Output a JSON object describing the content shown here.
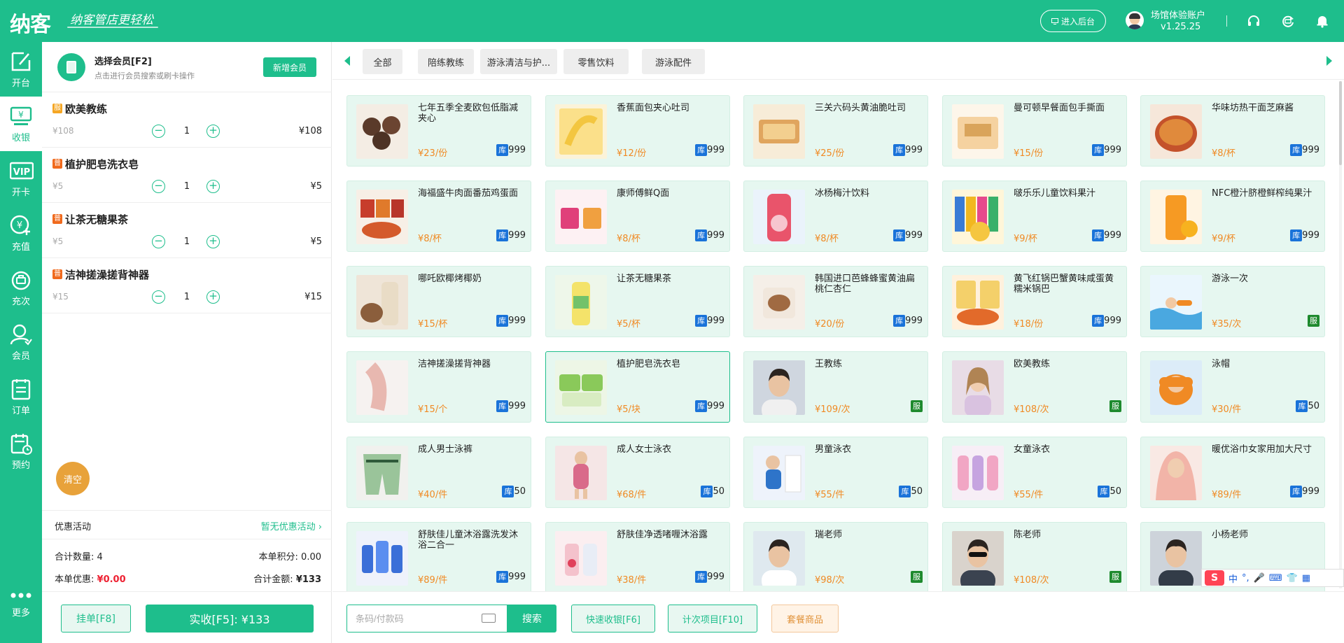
{
  "brand": {
    "logo": "纳客",
    "slogan": "纳客管店更轻松"
  },
  "header": {
    "backend_button": "进入后台",
    "account_name": "场馆体验账户",
    "version": "v1.25.25",
    "icons": [
      "headset-icon",
      "refresh-icon",
      "bell-icon"
    ]
  },
  "nav": [
    {
      "label": "开台",
      "icon": "edit-icon",
      "active": false
    },
    {
      "label": "收银",
      "icon": "cashier-icon",
      "active": true
    },
    {
      "label": "开卡",
      "icon": "vip-card-icon",
      "active": false
    },
    {
      "label": "充值",
      "icon": "recharge-icon",
      "active": false
    },
    {
      "label": "充次",
      "icon": "recharge-count-icon",
      "active": false
    },
    {
      "label": "会员",
      "icon": "member-icon",
      "active": false
    },
    {
      "label": "订单",
      "icon": "order-icon",
      "active": false
    },
    {
      "label": "预约",
      "icon": "calendar-icon",
      "active": false
    }
  ],
  "nav_more": "更多",
  "member": {
    "title": "选择会员[F2]",
    "hint": "点击进行会员搜索或刷卡操作",
    "new_member_button": "新增会员"
  },
  "cart_items": [
    {
      "tag": "服",
      "tag_type": "service",
      "name": "欧美教练",
      "unit_price": "¥108",
      "qty": "1",
      "subtotal": "¥108"
    },
    {
      "tag": "普",
      "tag_type": "normal",
      "name": "植护肥皂洗衣皂",
      "unit_price": "¥5",
      "qty": "1",
      "subtotal": "¥5"
    },
    {
      "tag": "普",
      "tag_type": "normal",
      "name": "让茶无糖果茶",
      "unit_price": "¥5",
      "qty": "1",
      "subtotal": "¥5"
    },
    {
      "tag": "普",
      "tag_type": "normal",
      "name": "洁神搓澡搓背神器",
      "unit_price": "¥15",
      "qty": "1",
      "subtotal": "¥15"
    }
  ],
  "cart": {
    "clear_button": "清空",
    "promo_label": "优惠活动",
    "promo_value": "暂无优惠活动",
    "total_qty_label": "合计数量:",
    "total_qty": "4",
    "points_label": "本单积分:",
    "points": "0.00",
    "discount_label": "本单优惠:",
    "discount": "¥0.00",
    "total_amount_label": "合计金额:",
    "total_amount": "¥133",
    "hang_button": "挂单[F8]",
    "pay_button": "实收[F5]: ¥133"
  },
  "categories": [
    {
      "label": "全部",
      "active": true
    },
    {
      "label": "陪练教练",
      "active": false
    },
    {
      "label": "游泳清洁与护...",
      "active": false
    },
    {
      "label": "零售饮料",
      "active": false
    },
    {
      "label": "游泳配件",
      "active": false
    }
  ],
  "products": [
    {
      "name": "七年五季全麦欧包低脂减夹心",
      "price": "¥23/份",
      "badge": "库",
      "stock": "999",
      "img": "bread"
    },
    {
      "name": "香蕉面包夹心吐司",
      "price": "¥12/份",
      "badge": "库",
      "stock": "999",
      "img": "banana"
    },
    {
      "name": "三关六码头黄油脆吐司",
      "price": "¥25/份",
      "badge": "库",
      "stock": "999",
      "img": "toast"
    },
    {
      "name": "曼可顿早餐面包手撕面",
      "price": "¥15/份",
      "badge": "库",
      "stock": "999",
      "img": "breadpack"
    },
    {
      "name": "华味坊热干面芝麻酱",
      "price": "¥8/杯",
      "badge": "库",
      "stock": "999",
      "img": "noodle"
    },
    {
      "name": "海福盛牛肉面番茄鸡蛋面",
      "price": "¥8/杯",
      "badge": "库",
      "stock": "999",
      "img": "cupnoodle"
    },
    {
      "name": "康师傅鲜Q面",
      "price": "¥8/杯",
      "badge": "库",
      "stock": "999",
      "img": "cups"
    },
    {
      "name": "冰杨梅汁饮料",
      "price": "¥8/杯",
      "badge": "库",
      "stock": "999",
      "img": "juice"
    },
    {
      "name": "啵乐乐儿童饮料果汁",
      "price": "¥9/杯",
      "badge": "库",
      "stock": "999",
      "img": "kids"
    },
    {
      "name": "NFC橙汁脐橙鲜榨纯果汁",
      "price": "¥9/杯",
      "badge": "库",
      "stock": "999",
      "img": "orange"
    },
    {
      "name": "哪吒欧椰烤椰奶",
      "price": "¥15/杯",
      "badge": "库",
      "stock": "999",
      "img": "coconut"
    },
    {
      "name": "让茶无糖果茶",
      "price": "¥5/杯",
      "badge": "库",
      "stock": "999",
      "img": "tea"
    },
    {
      "name": "韩国进口芭蜂蜂蜜黄油扁桃仁杏仁",
      "price": "¥20/份",
      "badge": "库",
      "stock": "999",
      "img": "almond"
    },
    {
      "name": "黄飞红锅巴蟹黄味咸蛋黄糯米锅巴",
      "price": "¥18/份",
      "badge": "库",
      "stock": "999",
      "img": "snack"
    },
    {
      "name": "游泳一次",
      "price": "¥35/次",
      "badge": "服",
      "stock": "",
      "img": "swim"
    },
    {
      "name": "洁神搓澡搓背神器",
      "price": "¥15/个",
      "badge": "库",
      "stock": "999",
      "img": "scrub"
    },
    {
      "name": "植护肥皂洗衣皂",
      "price": "¥5/块",
      "badge": "库",
      "stock": "999",
      "img": "soap",
      "selected": true
    },
    {
      "name": "王教练",
      "price": "¥109/次",
      "badge": "服",
      "stock": "",
      "img": "man1"
    },
    {
      "name": "欧美教练",
      "price": "¥108/次",
      "badge": "服",
      "stock": "",
      "img": "woman1"
    },
    {
      "name": "泳帽",
      "price": "¥30/件",
      "badge": "库",
      "stock": "50",
      "img": "cap"
    },
    {
      "name": "成人男士泳裤",
      "price": "¥40/件",
      "badge": "库",
      "stock": "50",
      "img": "shorts"
    },
    {
      "name": "成人女士泳衣",
      "price": "¥68/件",
      "badge": "库",
      "stock": "50",
      "img": "swimsuit"
    },
    {
      "name": "男童泳衣",
      "price": "¥55/件",
      "badge": "库",
      "stock": "50",
      "img": "boy"
    },
    {
      "name": "女童泳衣",
      "price": "¥55/件",
      "badge": "库",
      "stock": "50",
      "img": "girls"
    },
    {
      "name": "暖优浴巾女家用加大尺寸",
      "price": "¥89/件",
      "badge": "库",
      "stock": "999",
      "img": "towel"
    },
    {
      "name": "舒肤佳儿童沐浴露洗发沐浴二合一",
      "price": "¥89/件",
      "badge": "库",
      "stock": "999",
      "img": "bottles"
    },
    {
      "name": "舒肤佳净透啫喱沐浴露",
      "price": "¥38/件",
      "badge": "库",
      "stock": "999",
      "img": "gel"
    },
    {
      "name": "瑞老师",
      "price": "¥98/次",
      "badge": "服",
      "stock": "",
      "img": "man2"
    },
    {
      "name": "陈老师",
      "price": "¥108/次",
      "badge": "服",
      "stock": "",
      "img": "man3"
    },
    {
      "name": "小杨老师",
      "price": "",
      "badge": "",
      "stock": "",
      "img": "man4"
    }
  ],
  "bottom": {
    "barcode_placeholder": "条码/付款码",
    "search_button": "搜索",
    "quick_cash_button": "快速收银[F6]",
    "count_item_button": "计次项目[F10]",
    "package_button": "套餐商品"
  },
  "ime": {
    "logo": "S",
    "mode": "中"
  },
  "colors": {
    "primary": "#1ebe8c",
    "price": "#f08a24",
    "stock_badge": "#1a73d9",
    "service_badge": "#1e8a2e",
    "discount": "#e22233"
  }
}
